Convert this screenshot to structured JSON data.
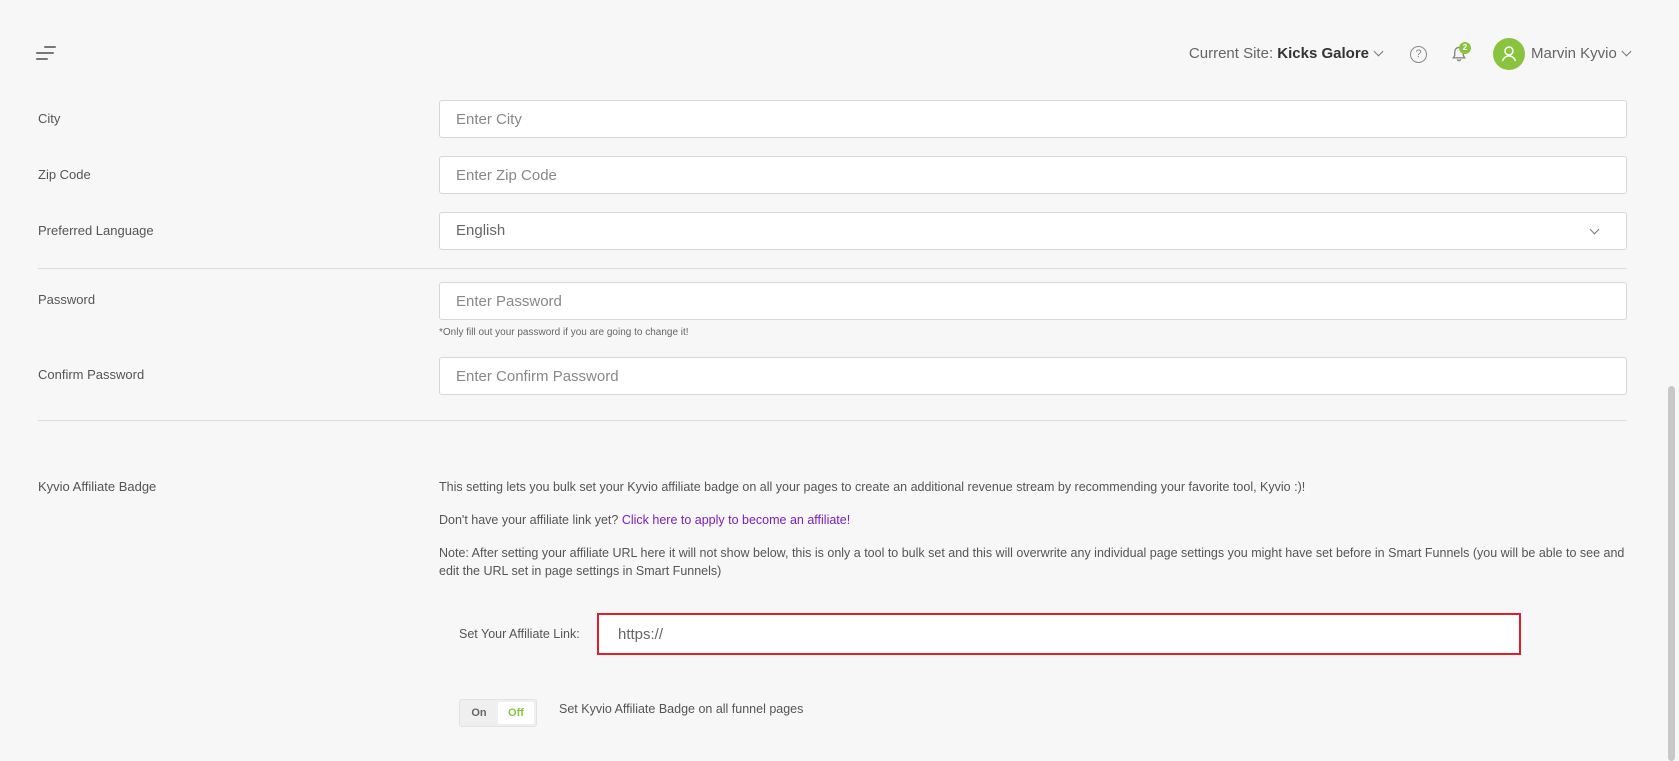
{
  "header": {
    "current_site_label": "Current Site:",
    "current_site_value": "Kicks Galore",
    "notification_count": "2",
    "user_name": "Marvin Kyvio",
    "help_icon": "question-circle-icon",
    "bell_icon": "bell-icon"
  },
  "form": {
    "city": {
      "label": "City",
      "placeholder": "Enter City"
    },
    "zip": {
      "label": "Zip Code",
      "placeholder": "Enter Zip Code"
    },
    "language": {
      "label": "Preferred Language",
      "value": "English"
    },
    "password": {
      "label": "Password",
      "placeholder": "Enter Password",
      "hint": "*Only fill out your password if you are going to change it!"
    },
    "confirm_password": {
      "label": "Confirm Password",
      "placeholder": "Enter Confirm Password"
    }
  },
  "affiliate": {
    "label": "Kyvio Affiliate Badge",
    "description": "This setting lets you bulk set your Kyvio affiliate badge on all your pages to create an additional revenue stream by recommending your favorite tool, Kyvio :)!",
    "no_link_text": "Don't have your affiliate link yet?",
    "apply_link": "Click here to apply to become an affiliate!",
    "note": "Note: After setting your affiliate URL here it will not show below, this is only a tool to bulk set and this will overwrite any individual page settings you might have set before in Smart Funnels (you will be able to see and edit the URL set in page settings in Smart Funnels)",
    "link_label": "Set Your Affiliate Link:",
    "link_value": "https://",
    "toggle_on": "On",
    "toggle_off": "Off",
    "toggle_label": "Set Kyvio Affiliate Badge on all funnel pages"
  },
  "colors": {
    "accent_green": "#8ac43f",
    "link_purple": "#7b1fbf",
    "highlight_red": "#e21e26"
  }
}
